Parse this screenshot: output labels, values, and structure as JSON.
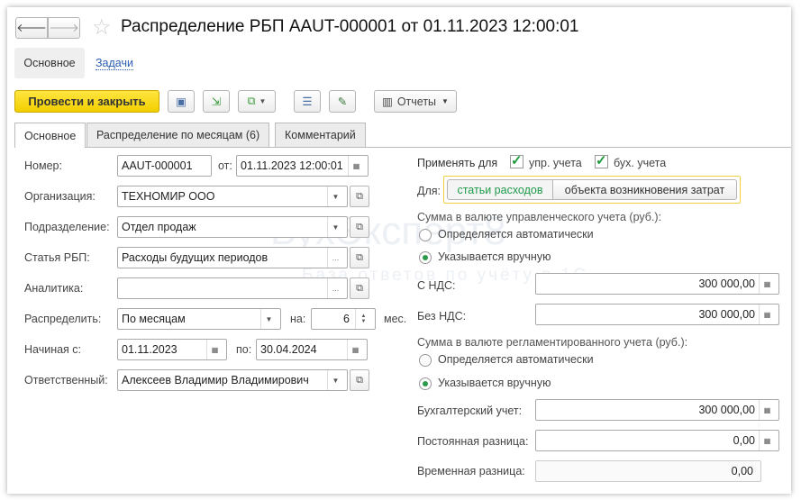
{
  "title": "Распределение РБП AAUT-000001 от 01.11.2023 12:00:01",
  "nav": {
    "main": "Основное",
    "tasks": "Задачи"
  },
  "toolbar": {
    "post_close": "Провести и закрыть",
    "reports": "Отчеты"
  },
  "tabs": [
    "Основное",
    "Распределение по месяцам (6)",
    "Комментарий"
  ],
  "form": {
    "number_label": "Номер:",
    "number": "AAUT-000001",
    "from_label": "от:",
    "date": "01.11.2023 12:00:01",
    "org_label": "Организация:",
    "org": "ТЕХНОМИР ООО",
    "dept_label": "Подразделение:",
    "dept": "Отдел продаж",
    "item_label": "Статья РБП:",
    "item": "Расходы будущих периодов",
    "analytics_label": "Аналитика:",
    "analytics": "",
    "distribute_label": "Распределить:",
    "distribute": "По месяцам",
    "on_label": "на:",
    "months": "6",
    "months_unit": "мес.",
    "start_label": "Начиная с:",
    "start": "01.11.2023",
    "to_label": "по:",
    "end": "30.04.2024",
    "resp_label": "Ответственный:",
    "resp": "Алексеев Владимир Владимирович"
  },
  "right": {
    "apply_label": "Применять для",
    "mgmt": "упр. учета",
    "acct": "бух. учета",
    "for_label": "Для:",
    "for_options": [
      "статьи расходов",
      "объекта возникновения затрат"
    ],
    "mgmt_sum_label": "Сумма в валюте управленческого учета (руб.):",
    "auto": "Определяется автоматически",
    "manual": "Указывается вручную",
    "with_vat_label": "С НДС:",
    "with_vat": "300 000,00",
    "no_vat_label": "Без НДС:",
    "no_vat": "300 000,00",
    "reg_sum_label": "Сумма в валюте регламентированного учета (руб.):",
    "acct_label": "Бухгалтерский учет:",
    "acct_value": "300 000,00",
    "perm_label": "Постоянная разница:",
    "perm": "0,00",
    "temp_label": "Временная разница:",
    "temp": "0,00"
  },
  "watermark": {
    "brand": "БухЭксперт8",
    "tagline": "База ответов по учёту в 1С"
  }
}
